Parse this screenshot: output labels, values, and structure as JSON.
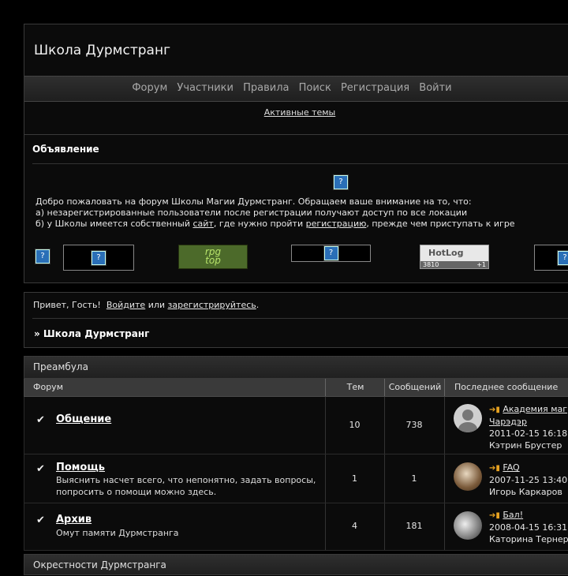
{
  "site": {
    "title": "Школа Дурмстранг"
  },
  "nav": {
    "items": [
      "Форум",
      "Участники",
      "Правила",
      "Поиск",
      "Регистрация",
      "Войти"
    ]
  },
  "sublinks": {
    "active_topics": "Активные темы"
  },
  "announcement": {
    "title": "Объявление",
    "line1": "Добро пожаловать на форум Школы Магии Дурмстранг. Обращаем ваше внимание на то, что:",
    "line2": "а) незарегистрированные пользователи после регистрации получают доступ по все локации",
    "line3_a": "б) у Школы имеется собственный ",
    "line3_link1": "сайт",
    "line3_b": ", где нужно пройти ",
    "line3_link2": "регистрацию",
    "line3_c": ", прежде чем приступать к игре",
    "rpg_banner": "rpg\ntop",
    "hotlog": {
      "label": "HotLog",
      "count": "3810",
      "delta": "+1"
    }
  },
  "guest": {
    "greeting": "Привет, Гость!",
    "login_link": "Войдите",
    "or": "или",
    "register_link": "зарегистрируйтесь",
    "end": "."
  },
  "breadcrumb": "» Школа Дурмстранг",
  "category": {
    "title": "Преамбула",
    "headers": {
      "forum": "Форум",
      "topics": "Тем",
      "posts": "Сообщений",
      "last": "Последнее сообщение"
    },
    "forums": [
      {
        "name": "Общение",
        "desc": "",
        "topics": "10",
        "posts": "738",
        "last_title": "Академия маг",
        "last_title2": "Чарэдэр",
        "last_date": "2011-02-15 16:18",
        "last_author": "Кэтрин Брустер"
      },
      {
        "name": "Помощь",
        "desc": "Выяснить насчет всего, что непонятно, задать вопросы, попросить о помощи можно здесь.",
        "topics": "1",
        "posts": "1",
        "last_title": "FAQ",
        "last_title2": "",
        "last_date": "2007-11-25 13:40",
        "last_author": "Игорь Каркаров"
      },
      {
        "name": "Архив",
        "desc": "Омут памяти Дурмстранга",
        "topics": "4",
        "posts": "181",
        "last_title": "Бал!",
        "last_title2": "",
        "last_date": "2008-04-15 16:31",
        "last_author": "Каторина Тернер"
      }
    ]
  },
  "category2": {
    "title": "Окрестности Дурмстранга"
  },
  "colors": {
    "background": "#000000",
    "panel": "#0b0b0b",
    "header_bar": "#3a3a3a",
    "accent_arrow": "#e8a321"
  }
}
